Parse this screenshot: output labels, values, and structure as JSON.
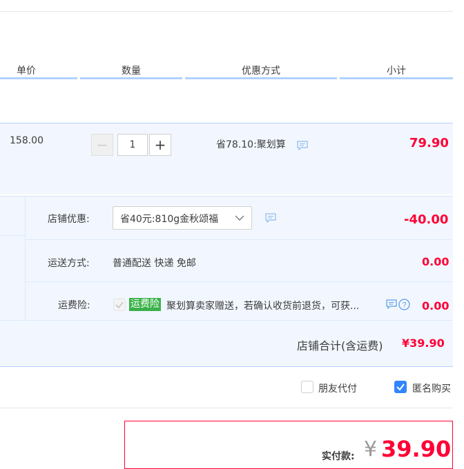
{
  "columns": {
    "unit_price": "单价",
    "quantity": "数量",
    "discount": "优惠方式",
    "subtotal": "小计"
  },
  "item": {
    "unit_price": "158.00",
    "quantity": "1",
    "decrement_symbol": "−",
    "increment_symbol": "+",
    "discount_text": "省78.10:聚划算",
    "subtotal": "79.90"
  },
  "shop": {
    "coupon_label": "店铺优惠:",
    "coupon_selected": "省40元:810g金秋颂福",
    "coupon_amount": "-40.00",
    "shipping_label": "运送方式:",
    "shipping_text": "普通配送 快递 免邮",
    "shipping_amount": "0.00",
    "insurance_label": "运费险:",
    "insurance_badge": "运费险",
    "insurance_text": "聚划算卖家赠送，若确认收货前退货，可获...",
    "insurance_amount": "0.00",
    "total_label": "店铺合计(含运费)",
    "total_value": "¥39.90"
  },
  "options": {
    "friend_pay_label": "朋友代付",
    "friend_pay_checked": false,
    "anonymous_label": "匿名购买",
    "anonymous_checked": true
  },
  "payment": {
    "label": "实付款:",
    "currency": "¥",
    "amount": "39.90"
  },
  "colors": {
    "accent_red": "#ff0036",
    "header_blue": "#b2d1ff",
    "row_bg": "#f2f7ff",
    "check_blue": "#3385ff",
    "badge_green": "#3bb149"
  }
}
